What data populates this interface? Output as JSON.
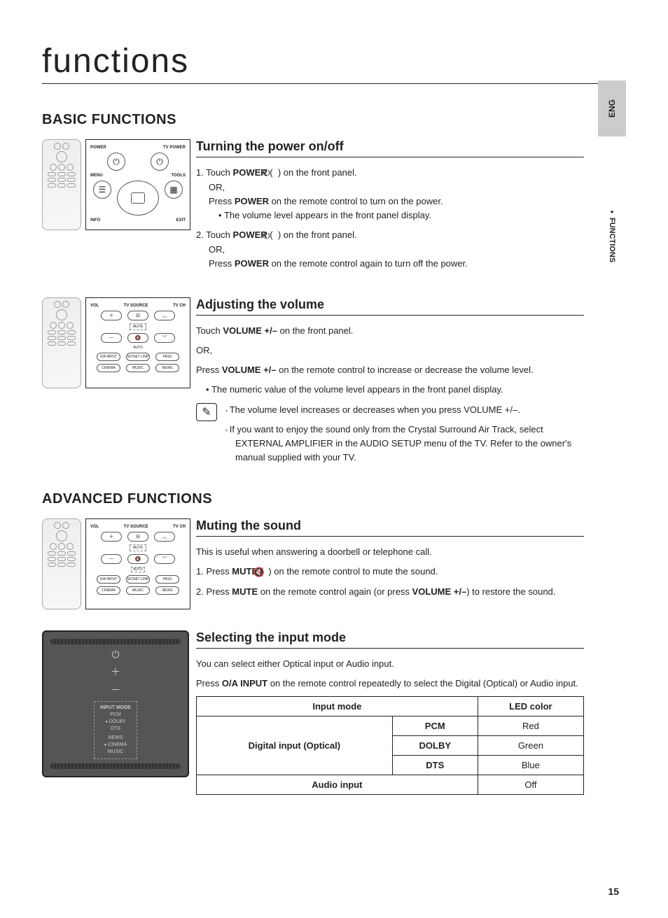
{
  "lang_tab": "ENG",
  "side_label": "FUNCTIONS",
  "page_title": "functions",
  "page_number": "15",
  "remote1": {
    "power": "POWER",
    "tv_power": "TV POWER",
    "menu": "MENU",
    "tools": "TOOLS",
    "info": "INFO",
    "exit": "EXIT"
  },
  "remote2": {
    "vol": "VOL",
    "tv_source": "TV SOURCE",
    "tv_ch": "TV CH",
    "mute": "MUTE",
    "auto": "AUTO",
    "oa_input": "O/A INPUT",
    "sound_link": "S/CNET LINK",
    "pass": "PASS",
    "cinema": "CINEMA",
    "music": "MUSIC",
    "news": "NEWS"
  },
  "device": {
    "input_mode": "INPUT MODE",
    "pcm": "PCM",
    "dolby": "DOLBY",
    "dts": "DTS",
    "news": "NEWS",
    "cinema": "CINEMA",
    "music": "MUSIC"
  },
  "basic": {
    "heading": "BASIC FUNCTIONS",
    "power": {
      "heading": "Turning the power on/off",
      "step1_a": "1. Touch ",
      "step1_b": "POWER",
      "step1_c": " ( ",
      "step1_d": " ) on the front panel.",
      "or": "OR,",
      "step1_e": "Press ",
      "step1_f": "POWER",
      "step1_g": " on the remote control to turn on the power.",
      "bullet1": "The volume level appears in the front panel display.",
      "step2_a": "2. Touch ",
      "step2_b": "POWER",
      "step2_c": " ( ",
      "step2_d": " ) on the front panel.",
      "step2_e": "Press ",
      "step2_f": "POWER",
      "step2_g": " on the remote control again to turn off the power."
    },
    "volume": {
      "heading": "Adjusting the volume",
      "line1_a": "Touch ",
      "line1_b": "VOLUME +/–",
      "line1_c": " on the front panel.",
      "or": "OR,",
      "line2_a": "Press ",
      "line2_b": "VOLUME +/–",
      "line2_c": " on the remote control to increase or decrease the volume level.",
      "bullet1": "The numeric value of the volume level appears in the front panel display.",
      "note1": "The volume level increases or decreases when you press VOLUME +/–.",
      "note2": "If you want to enjoy the sound only from the Crystal Surround Air Track, select EXTERNAL AMPLIFIER in the AUDIO SETUP menu of the TV. Refer to the owner's manual supplied with your TV."
    }
  },
  "advanced": {
    "heading": "ADVANCED FUNCTIONS",
    "mute": {
      "heading": "Muting the sound",
      "intro": "This is useful when answering a doorbell or telephone call.",
      "step1_a": "1. Press ",
      "step1_b": "MUTE",
      "step1_c": " ( ",
      "step1_d": " ) on the remote control to mute the sound.",
      "step2_a": "2.  Press ",
      "step2_b": "MUTE",
      "step2_c": " on the remote control again (or press ",
      "step2_d": "VOLUME +/–",
      "step2_e": ") to restore the sound."
    },
    "input": {
      "heading": "Selecting the input mode",
      "intro": "You can select either Optical input or Audio input.",
      "line_a": "Press ",
      "line_b": "O/A INPUT",
      "line_c": " on the remote control repeatedly to select the Digital (Optical) or Audio input.",
      "table": {
        "h1": "Input mode",
        "h2": "LED color",
        "digital_label": "Digital input (Optical)",
        "r1c1": "PCM",
        "r1c2": "Red",
        "r2c1": "DOLBY",
        "r2c2": "Green",
        "r3c1": "DTS",
        "r3c2": "Blue",
        "r4c1": "Audio input",
        "r4c2": "Off"
      }
    }
  }
}
